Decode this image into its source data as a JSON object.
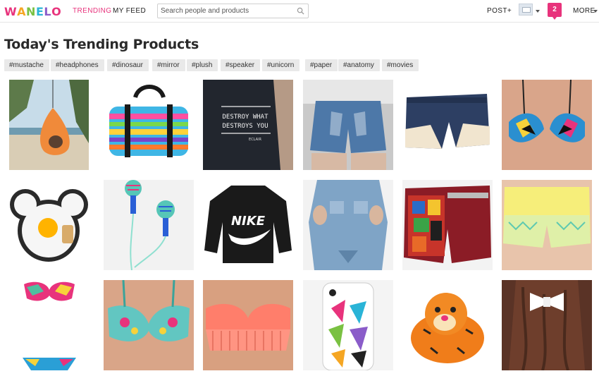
{
  "header": {
    "logo_letters": [
      "W",
      "A",
      "N",
      "E",
      "L",
      "O"
    ],
    "logo_colors": [
      "#e8337c",
      "#f5a623",
      "#7ac142",
      "#2ab4d7",
      "#8a5cc9",
      "#e8337c"
    ],
    "nav": {
      "trending": "TRENDING",
      "feed": "MY FEED"
    },
    "search": {
      "placeholder": "Search people and products"
    },
    "post_label": "POST+",
    "notification_count": "2",
    "more_label": "MORE",
    "accent_color": "#e8337c"
  },
  "page": {
    "title": "Today's Trending Products"
  },
  "tags": [
    "#mustache",
    "#headphones",
    "#dinosaur",
    "#mirror",
    "#plush",
    "#speaker",
    "#unicorn",
    "#paper",
    "#anatomy",
    "#movies"
  ],
  "products": [
    {
      "name": "hanging-pod-chair"
    },
    {
      "name": "striped-duffel-bag"
    },
    {
      "name": "destroy-what-destroys-you-sweatshirt",
      "print": "DESTROY WHAT DESTROYS YOU",
      "small_print": "ECLAIR"
    },
    {
      "name": "embellished-denim-shorts"
    },
    {
      "name": "lace-trim-denim-shorts"
    },
    {
      "name": "tribal-print-bikini-top"
    },
    {
      "name": "mickey-egg-mold"
    },
    {
      "name": "aztec-earbuds"
    },
    {
      "name": "nike-sweatshirt",
      "print": "NIKE"
    },
    {
      "name": "chambray-cold-shoulder-shirt"
    },
    {
      "name": "comic-print-studded-shorts"
    },
    {
      "name": "yellow-aztec-shorts"
    },
    {
      "name": "aztec-bikini-set"
    },
    {
      "name": "floral-bandeau-top"
    },
    {
      "name": "fringe-bikini-top"
    },
    {
      "name": "feather-phone-case"
    },
    {
      "name": "tigger-pillow-pet"
    },
    {
      "name": "white-hair-bow"
    }
  ]
}
